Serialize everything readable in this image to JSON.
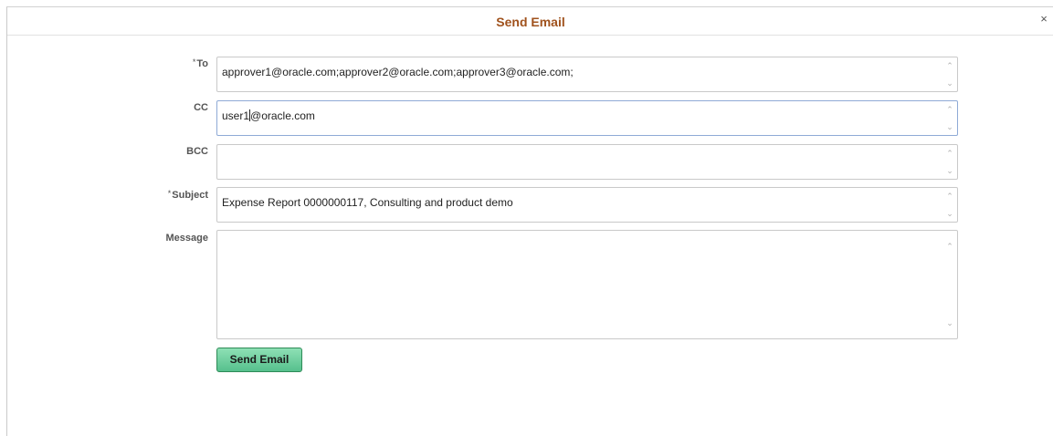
{
  "dialog": {
    "title": "Send Email",
    "close_glyph": "×"
  },
  "form": {
    "to": {
      "required_mark": "*",
      "label": "To",
      "value": "approver1@oracle.com;approver2@oracle.com;approver3@oracle.com;"
    },
    "cc": {
      "label": "CC",
      "value_before_cursor": "user1",
      "value_after_cursor": "@oracle.com"
    },
    "bcc": {
      "label": "BCC",
      "value": ""
    },
    "subject": {
      "required_mark": "*",
      "label": "Subject",
      "value": "Expense Report 0000000117, Consulting and product demo"
    },
    "message": {
      "label": "Message",
      "value": ""
    }
  },
  "actions": {
    "send_label": "Send Email"
  },
  "colors": {
    "title": "#a0521d",
    "button": "#56c08d",
    "focus_border": "#8faad6"
  },
  "icons": {
    "close": "close-icon",
    "scroll_up": "chevron-up-icon",
    "scroll_down": "chevron-down-icon"
  }
}
